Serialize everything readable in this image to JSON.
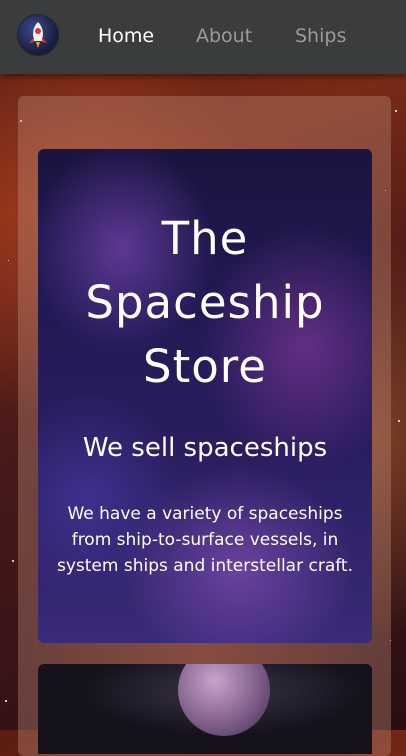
{
  "nav": {
    "items": [
      {
        "label": "Home",
        "active": true
      },
      {
        "label": "About",
        "active": false
      },
      {
        "label": "Ships",
        "active": false
      }
    ]
  },
  "logo": {
    "icon": "rocket-icon"
  },
  "hero": {
    "title": "The Spaceship Store",
    "subtitle": "We sell spaceships",
    "text": "We have a variety of spaceships from ship-to-surface vessels, in system ships and interstellar craft."
  },
  "colors": {
    "topbar": "#3b3c3e",
    "nav_active": "#ffffff",
    "nav_inactive": "#9b9b9b"
  }
}
